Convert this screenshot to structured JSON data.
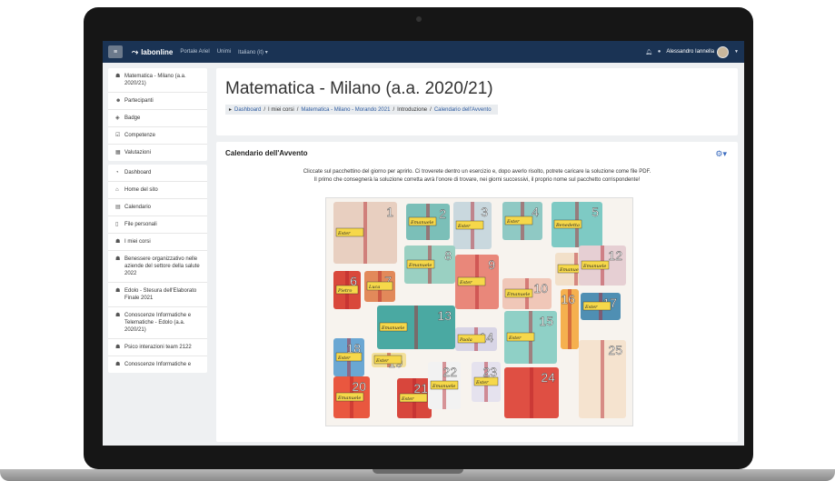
{
  "topbar": {
    "menu_glyph": "≡",
    "brand": "labonline",
    "links": [
      "Portale Ariel",
      "Unimi",
      "Italiano (it) ▾"
    ],
    "user_name": "Alessandro Iannella",
    "icons": [
      "bell-icon",
      "chat-icon"
    ]
  },
  "sidebar": {
    "group1": [
      {
        "icon": "☗",
        "label": "Matematica - Milano (a.a. 2020/21)"
      },
      {
        "icon": "☻",
        "label": "Partecipanti"
      },
      {
        "icon": "◈",
        "label": "Badge"
      },
      {
        "icon": "☑",
        "label": "Competenze"
      },
      {
        "icon": "▦",
        "label": "Valutazioni"
      }
    ],
    "group2": [
      {
        "icon": "◔",
        "label": "Dashboard"
      },
      {
        "icon": "⌂",
        "label": "Home del sito"
      },
      {
        "icon": "▤",
        "label": "Calendario"
      },
      {
        "icon": "▯",
        "label": "File personali"
      },
      {
        "icon": "☗",
        "label": "I miei corsi"
      },
      {
        "icon": "☗",
        "label": "Benessere organizzativo nelle aziende del settore della salute 2022"
      },
      {
        "icon": "☗",
        "label": "Edolo - Stesura dell'Elaborato Finale 2021"
      },
      {
        "icon": "☗",
        "label": "Conoscenze Informatiche e Telematiche - Edolo (a.a. 2020/21)"
      },
      {
        "icon": "☗",
        "label": "Psico interazioni team 2122"
      },
      {
        "icon": "☗",
        "label": "Conoscenze Informatiche e"
      }
    ]
  },
  "header": {
    "title": "Matematica - Milano (a.a. 2020/21)",
    "breadcrumb": [
      "Dashboard",
      "I miei corsi",
      "Matematica - Milano - Morando 2021",
      "Introduzione",
      "Calendario dell'Avvento"
    ]
  },
  "main": {
    "card_title": "Calendario dell'Avvento",
    "intro_line1": "Cliccate sul pacchettino del giorno per aprirlo. Ci troverete dentro un esercizio e, dopo averlo risolto, potrete caricare la soluzione come file PDF.",
    "intro_line2": "Il primo che consegnerà la soluzione corretta avrà l'onore di trovare, nei giorni successivi, il proprio nome sul pacchetto corrispondente!"
  },
  "calendar": {
    "days": [
      {
        "n": "1",
        "name": "Ester",
        "color": "#e8cfc0"
      },
      {
        "n": "2",
        "name": "Emanuele",
        "color": "#7bbfb8"
      },
      {
        "n": "3",
        "name": "Ester",
        "color": "#c9d8de"
      },
      {
        "n": "4",
        "name": "Ester",
        "color": "#8fc9c4"
      },
      {
        "n": "5",
        "name": "Benedetta",
        "color": "#7ecac4"
      },
      {
        "n": "6",
        "name": "Pietro",
        "color": "#d9483b"
      },
      {
        "n": "7",
        "name": "Luca",
        "color": "#e2895a"
      },
      {
        "n": "8",
        "name": "Emanuele",
        "color": "#9ad0c2"
      },
      {
        "n": "9",
        "name": "Ester",
        "color": "#e9877a"
      },
      {
        "n": "10",
        "name": "Emanuele",
        "color": "#f0c7b8"
      },
      {
        "n": "11",
        "name": "Emanuele",
        "color": "#f2e0c9"
      },
      {
        "n": "12",
        "name": "Emanuele",
        "color": "#e6cfd3"
      },
      {
        "n": "13",
        "name": "Emanuele",
        "color": "#4aa9a2"
      },
      {
        "n": "14",
        "name": "Paola",
        "color": "#d8d5e6"
      },
      {
        "n": "15",
        "name": "Ester",
        "color": "#8fd0c6"
      },
      {
        "n": "16",
        "name": "",
        "color": "#f5b04f"
      },
      {
        "n": "17",
        "name": "Ester",
        "color": "#4f8fb3"
      },
      {
        "n": "18",
        "name": "Ester",
        "color": "#6aa7d3"
      },
      {
        "n": "19",
        "name": "Ester",
        "color": "#f3e09a"
      },
      {
        "n": "20",
        "name": "Emanuele",
        "color": "#e9573f"
      },
      {
        "n": "21",
        "name": "Ester",
        "color": "#d8463c"
      },
      {
        "n": "22",
        "name": "Emanuele",
        "color": "#f2f2f2"
      },
      {
        "n": "23",
        "name": "Ester",
        "color": "#e5e2ee"
      },
      {
        "n": "24",
        "name": "",
        "color": "#df4f43"
      },
      {
        "n": "25",
        "name": "",
        "color": "#f5e3cf"
      }
    ]
  }
}
